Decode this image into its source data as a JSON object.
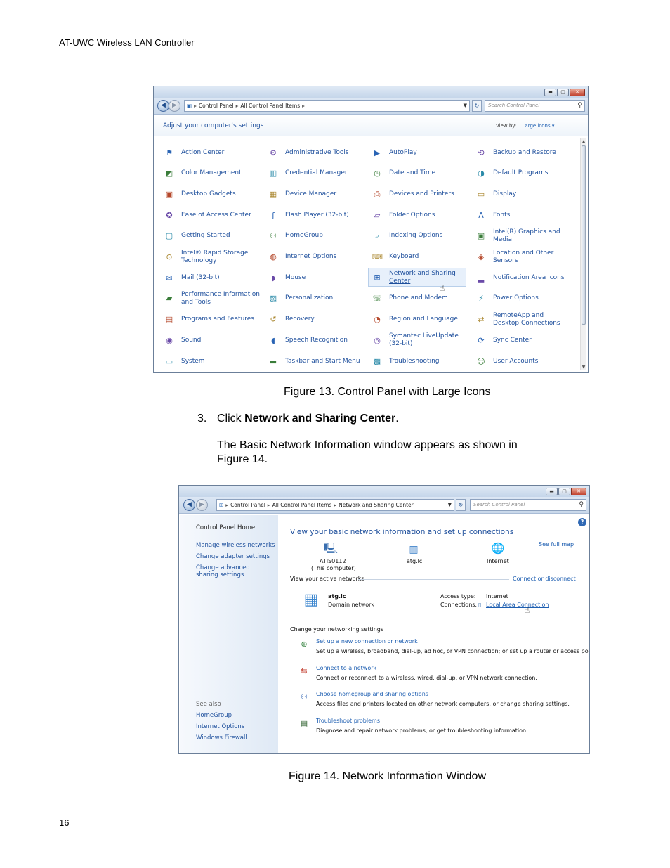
{
  "document": {
    "header": "AT-UWC Wireless LAN Controller",
    "page_number": "16",
    "figure13_caption": "Figure 13. Control Panel with Large Icons",
    "step_number": "3.",
    "step_prefix": "Click ",
    "step_bold": "Network and Sharing Center",
    "step_suffix": ".",
    "para_line1": "The Basic Network Information window appears as shown in",
    "para_line2": "Figure 14.",
    "figure14_caption": "Figure 14. Network Information Window"
  },
  "window1": {
    "breadcrumb": [
      "Control Panel",
      "All Control Panel Items"
    ],
    "search_placeholder": "Search Control Panel",
    "heading": "Adjust your computer's settings",
    "view_by_label": "View by:",
    "view_by_value": "Large icons",
    "items": [
      [
        "Action Center",
        "Color Management",
        "Desktop Gadgets",
        "Ease of Access Center",
        "Getting Started",
        "Intel® Rapid Storage Technology",
        "Mail (32-bit)",
        "Performance Information and Tools",
        "Programs and Features",
        "Sound",
        "System"
      ],
      [
        "Administrative Tools",
        "Credential Manager",
        "Device Manager",
        "Flash Player (32-bit)",
        "HomeGroup",
        "Internet Options",
        "Mouse",
        "Personalization",
        "Recovery",
        "Speech Recognition",
        "Taskbar and Start Menu"
      ],
      [
        "AutoPlay",
        "Date and Time",
        "Devices and Printers",
        "Folder Options",
        "Indexing Options",
        "Keyboard",
        "Network and Sharing Center",
        "Phone and Modem",
        "Region and Language",
        "Symantec LiveUpdate (32-bit)",
        "Troubleshooting"
      ],
      [
        "Backup and Restore",
        "Default Programs",
        "Display",
        "Fonts",
        "Intel(R) Graphics and Media",
        "Location and Other Sensors",
        "Notification Area Icons",
        "Power Options",
        "RemoteApp and Desktop Connections",
        "Sync Center",
        "User Accounts"
      ]
    ],
    "icons": [
      [
        "flag-icon",
        "color-icon",
        "gadget-icon",
        "access-icon",
        "start-icon",
        "storage-icon",
        "mail-icon",
        "perf-icon",
        "programs-icon",
        "sound-icon",
        "system-icon"
      ],
      [
        "tools-icon",
        "credential-icon",
        "device-icon",
        "flash-icon",
        "homegroup-icon",
        "globe-icon",
        "mouse-icon",
        "paint-icon",
        "recovery-icon",
        "mic-icon",
        "taskbar-icon"
      ],
      [
        "autoplay-icon",
        "clock-icon",
        "printer-icon",
        "folder-icon",
        "indexing-icon",
        "keyboard-icon",
        "network-icon",
        "phone-icon",
        "region-icon",
        "liveupdate-icon",
        "troubleshoot-icon"
      ],
      [
        "backup-icon",
        "default-icon",
        "display-icon",
        "fonts-icon",
        "graphics-icon",
        "sensor-icon",
        "notification-icon",
        "power-icon",
        "remote-icon",
        "sync-icon",
        "users-icon"
      ]
    ]
  },
  "window2": {
    "breadcrumb": [
      "Control Panel",
      "All Control Panel Items",
      "Network and Sharing Center"
    ],
    "search_placeholder": "Search Control Panel",
    "left_home": "Control Panel Home",
    "left_links": [
      "Manage wireless networks",
      "Change adapter settings",
      "Change advanced sharing settings"
    ],
    "see_also_label": "See also",
    "see_also": [
      "HomeGroup",
      "Internet Options",
      "Windows Firewall"
    ],
    "title": "View your basic network information and set up connections",
    "see_full_map": "See full map",
    "computer_name": "ATIS0112",
    "computer_sub": "(This computer)",
    "network_node": "atg.lc",
    "internet_node": "Internet",
    "active_label": "View your active networks",
    "connect_disconnect": "Connect or disconnect",
    "network_name": "atg.lc",
    "network_type": "Domain network",
    "access_type_label": "Access type:",
    "access_type_value": "Internet",
    "connections_label": "Connections:",
    "connections_value": "Local Area Connection",
    "change_label": "Change your networking settings",
    "tasks": [
      {
        "title": "Set up a new connection or network",
        "desc": "Set up a wireless, broadband, dial-up, ad hoc, or VPN connection; or set up a router or access point."
      },
      {
        "title": "Connect to a network",
        "desc": "Connect or reconnect to a wireless, wired, dial-up, or VPN network connection."
      },
      {
        "title": "Choose homegroup and sharing options",
        "desc": "Access files and printers located on other network computers, or change sharing settings."
      },
      {
        "title": "Troubleshoot problems",
        "desc": "Diagnose and repair network problems, or get troubleshooting information."
      }
    ]
  },
  "colors": {
    "link": "#1d5eb1",
    "border": "#6b7f99"
  }
}
